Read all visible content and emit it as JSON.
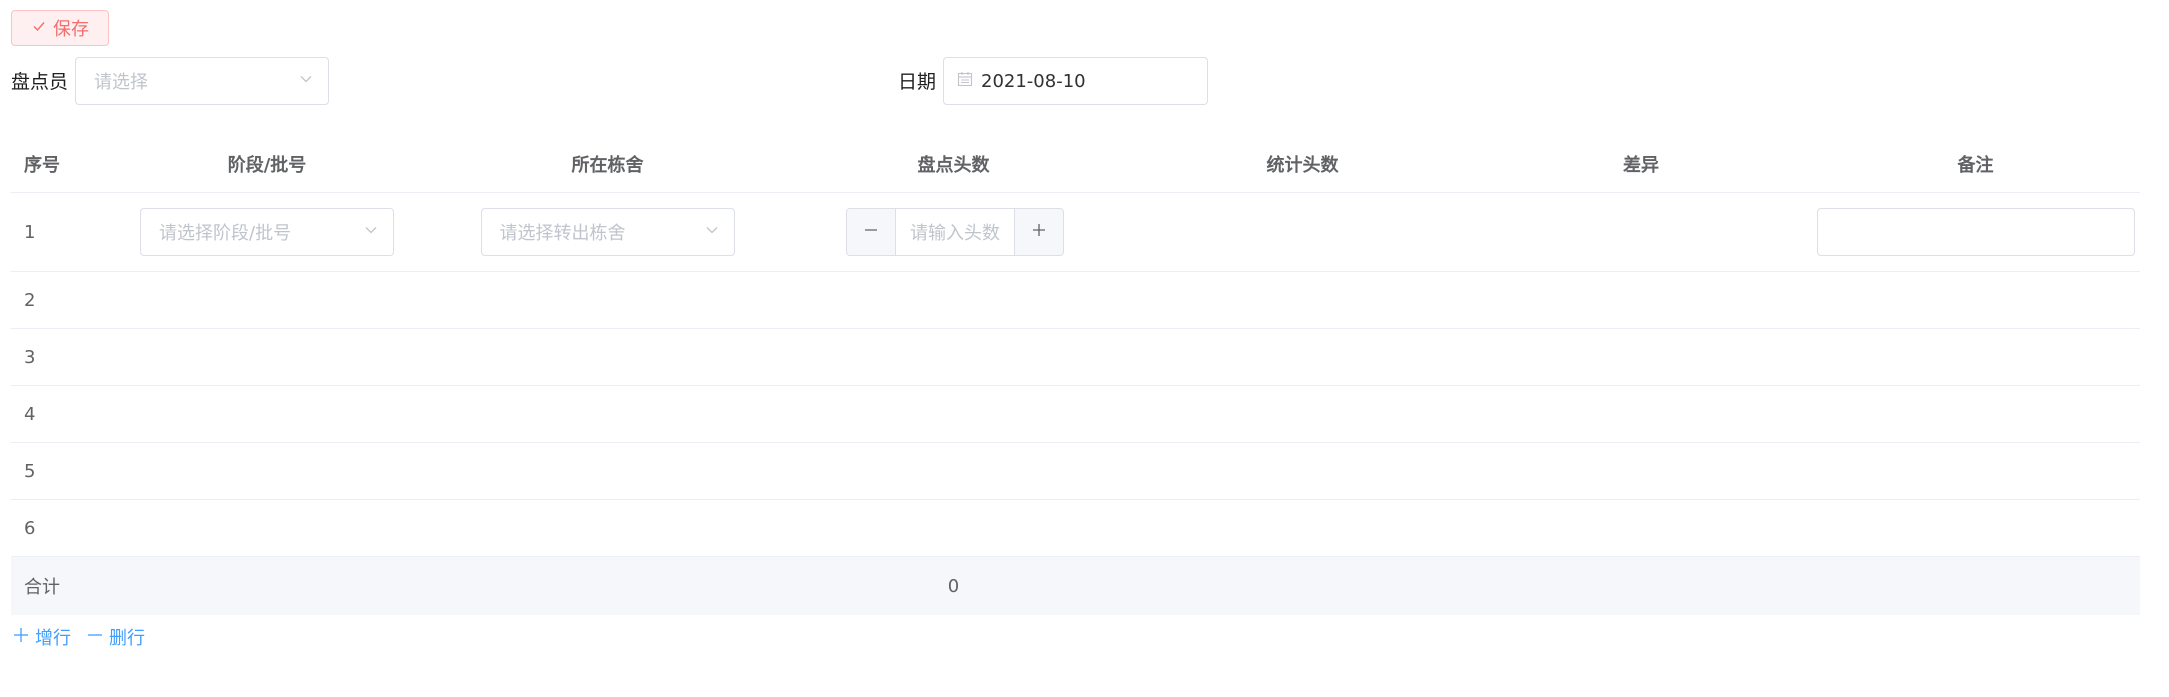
{
  "toolbar": {
    "save_label": "保存",
    "save_icon": "check-icon"
  },
  "form": {
    "checker_label": "盘点员",
    "checker_placeholder": "请选择",
    "date_label": "日期",
    "date_value": "2021-08-10"
  },
  "table": {
    "headers": {
      "index": "序号",
      "batch": "阶段/批号",
      "house": "所在栋舍",
      "head_count": "盘点头数",
      "stat_count": "统计头数",
      "diff": "差异",
      "note": "备注"
    },
    "first_row": {
      "index": "1",
      "batch_placeholder": "请选择阶段/批号",
      "house_placeholder": "请选择转出栋舍",
      "head_placeholder": "请输入头数"
    },
    "rows": [
      "2",
      "3",
      "4",
      "5",
      "6"
    ],
    "total": {
      "label": "合计",
      "head_count": "0"
    }
  },
  "actions": {
    "add_row": "增行",
    "delete_row": "删行"
  },
  "colors": {
    "danger": "#f56c6c",
    "primary": "#409eff",
    "border": "#dcdfe6"
  }
}
